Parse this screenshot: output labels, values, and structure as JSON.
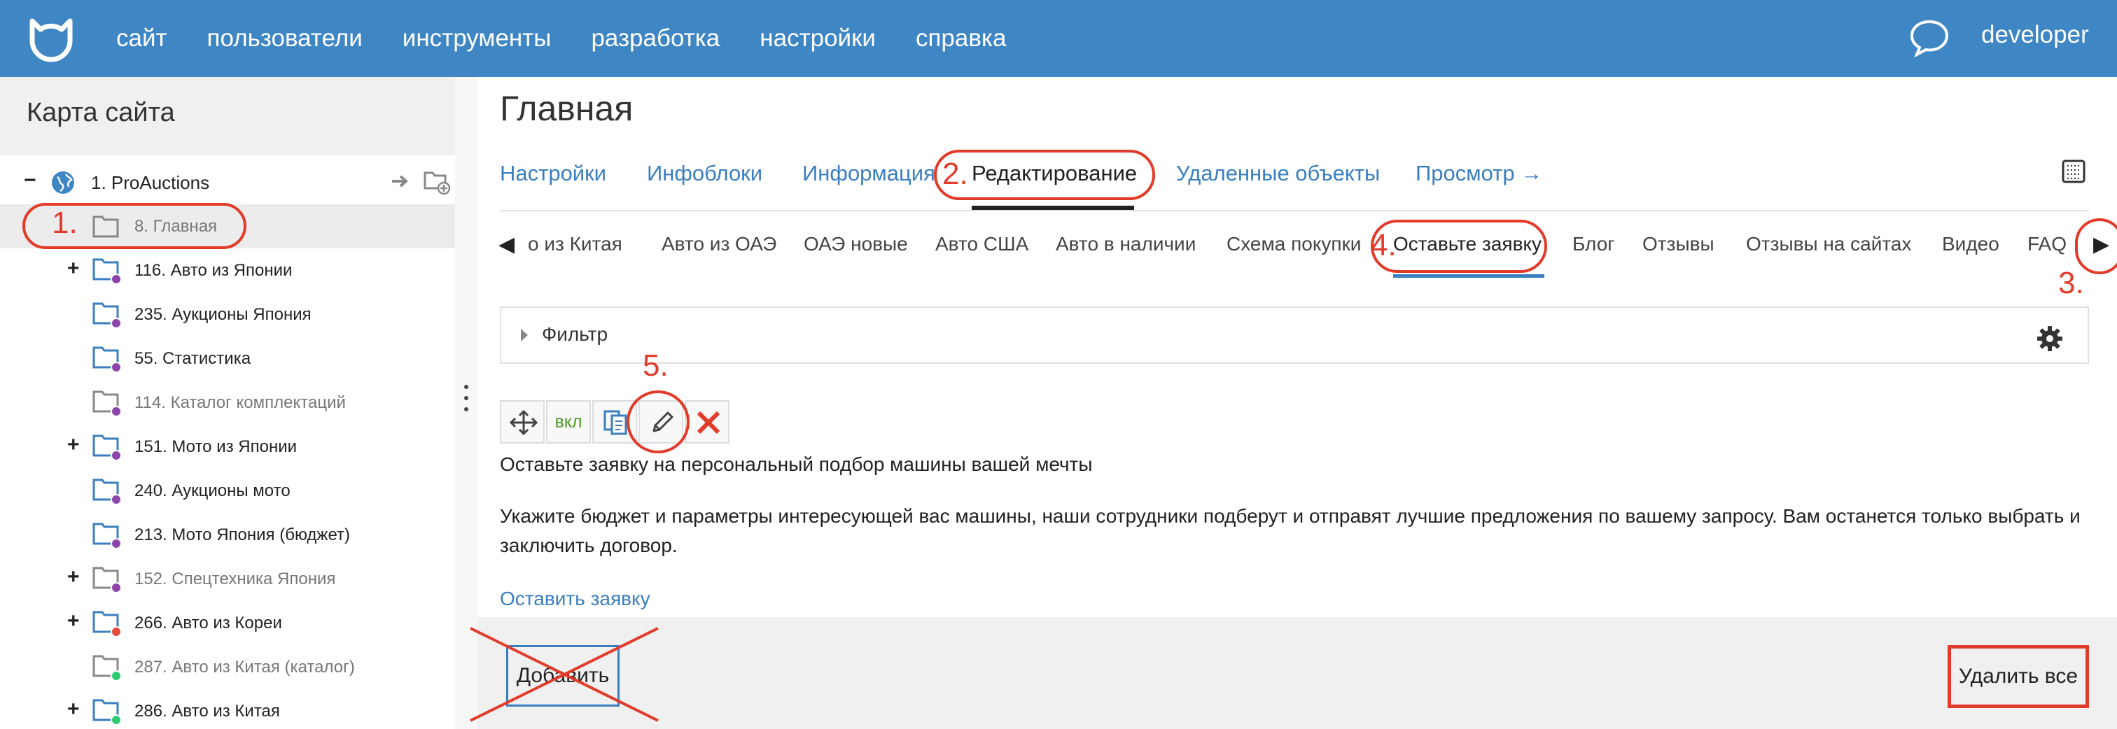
{
  "topbar": {
    "nav": [
      "сайт",
      "пользователи",
      "инструменты",
      "разработка",
      "настройки",
      "справка"
    ],
    "user": "developer",
    "icons": [
      "cat-logo-icon",
      "chat-icon"
    ]
  },
  "sidebar": {
    "title": "Карта сайта",
    "items": [
      {
        "label": "1. ProAuctions",
        "toggle": "−",
        "icon": "globe-icon"
      },
      {
        "label": "8. Главная",
        "toggle": "",
        "icon": "folder-icon"
      },
      {
        "label": "116. Авто из Японии",
        "toggle": "+",
        "icon": "folder-icon",
        "badge": "#8e44ad"
      },
      {
        "label": "235. Аукционы Япония",
        "toggle": "",
        "icon": "folder-icon",
        "badge": "#8e44ad"
      },
      {
        "label": "55. Статистика",
        "toggle": "",
        "icon": "folder-icon",
        "badge": "#8e44ad"
      },
      {
        "label": "114. Каталог комплектаций",
        "toggle": "",
        "icon": "folder-icon",
        "badge": "#8e44ad"
      },
      {
        "label": "151. Мото из Японии",
        "toggle": "+",
        "icon": "folder-icon",
        "badge": "#8e44ad"
      },
      {
        "label": "240. Аукционы мото",
        "toggle": "",
        "icon": "folder-icon",
        "badge": "#8e44ad"
      },
      {
        "label": "213. Мото Япония (бюджет)",
        "toggle": "",
        "icon": "folder-icon",
        "badge": "#8e44ad"
      },
      {
        "label": "152. Спецтехника Япония",
        "toggle": "+",
        "icon": "folder-icon",
        "badge": "#8e44ad"
      },
      {
        "label": "266. Авто из Кореи",
        "toggle": "+",
        "icon": "folder-icon",
        "badge": "#e74c3c"
      },
      {
        "label": "287. Авто из Китая (каталог)",
        "toggle": "",
        "icon": "folder-icon",
        "badge": "#2ecc71"
      },
      {
        "label": "286. Авто из Китая",
        "toggle": "+",
        "icon": "folder-icon",
        "badge": "#2ecc71"
      }
    ]
  },
  "main": {
    "title": "Главная",
    "tabs": [
      "Настройки",
      "Инфоблоки",
      "Информация",
      "Редактирование",
      "Удаленные объекты",
      "Просмотр →"
    ],
    "subtabs": [
      "о из Китая",
      "Авто из ОАЭ",
      "ОАЭ новые",
      "Авто США",
      "Авто в наличии",
      "Схема покупки",
      "Оставьте заявку",
      "Блог",
      "Отзывы",
      "Отзывы на сайтах",
      "Видео",
      "FAQ"
    ],
    "filter_label": "Фильтр",
    "toolbar_on_label": "вкл",
    "text1": "Оставьте заявку на персональный подбор машины вашей мечты",
    "text2": "Укажите бюджет и параметры интересующей вас машины, наши сотрудники подберут и отправят лучшие предложения по вашему запросу. Вам останется только выбрать и",
    "text3": "заключить договор.",
    "link": "Оставить заявку",
    "add_label": "Добавить",
    "delete_all_label": "Удалить все"
  },
  "annotations": [
    "1.",
    "2.",
    "3.",
    "4.",
    "5."
  ],
  "colors": {
    "header": "#3f86c4",
    "link": "#3a7fbf",
    "annotation": "#e23b2a"
  }
}
